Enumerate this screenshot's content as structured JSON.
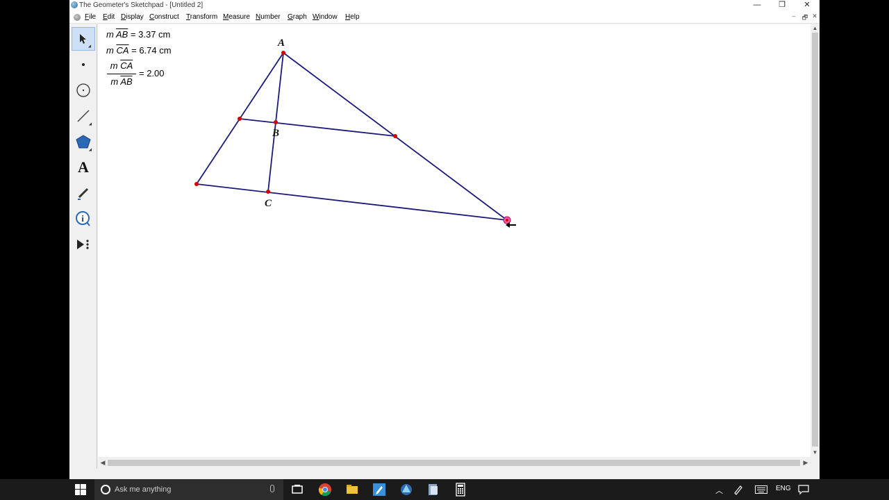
{
  "window": {
    "title": "The Geometer's Sketchpad - [Untitled 2]",
    "minimize": "—",
    "restore": "❐",
    "close": "✕"
  },
  "menu": [
    {
      "label": "File",
      "u": "F",
      "rest": "ile"
    },
    {
      "label": "Edit",
      "u": "E",
      "rest": "dit"
    },
    {
      "label": "Display",
      "u": "D",
      "rest": "isplay"
    },
    {
      "label": "Construct",
      "u": "C",
      "rest": "onstruct"
    },
    {
      "label": "Transform",
      "u": "T",
      "rest": "ransform"
    },
    {
      "label": "Measure",
      "u": "M",
      "rest": "easure"
    },
    {
      "label": "Number",
      "u": "N",
      "rest": "umber"
    },
    {
      "label": "Graph",
      "u": "G",
      "rest": "raph"
    },
    {
      "label": "Window",
      "u": "W",
      "rest": "indow"
    },
    {
      "label": "Help",
      "u": "H",
      "rest": "elp"
    }
  ],
  "mdi": {
    "minimize": "–",
    "restore": "🗗",
    "close": "✕"
  },
  "tools": [
    {
      "name": "arrow-tool",
      "icon": "arrow-icon",
      "active": true
    },
    {
      "name": "point-tool",
      "icon": "point-icon"
    },
    {
      "name": "compass-tool",
      "icon": "compass-icon"
    },
    {
      "name": "straightedge-tool",
      "icon": "straightedge-icon"
    },
    {
      "name": "polygon-tool",
      "icon": "polygon-icon"
    },
    {
      "name": "text-tool",
      "icon": "text-icon",
      "glyph": "A"
    },
    {
      "name": "marker-tool",
      "icon": "marker-icon"
    },
    {
      "name": "information-tool",
      "icon": "information-icon",
      "glyph": "i"
    },
    {
      "name": "custom-tool",
      "icon": "custom-tool-icon"
    }
  ],
  "measurements": {
    "m1": {
      "prefix": "m ",
      "seg": "AB",
      "rest": " = 3.37 cm"
    },
    "m2": {
      "prefix": "m ",
      "seg": "CA",
      "rest": " = 6.74 cm"
    },
    "ratio": {
      "num_prefix": "m ",
      "num_seg": "CA",
      "den_prefix": "m ",
      "den_seg": "AB",
      "value": " = 2.00"
    }
  },
  "sketch": {
    "labels": {
      "A": "A",
      "B": "B",
      "C": "C"
    },
    "line_color": "#1a1a7a",
    "point_color": "#d40000"
  },
  "taskbar": {
    "search_placeholder": "Ask me anything",
    "language": "ENG"
  }
}
